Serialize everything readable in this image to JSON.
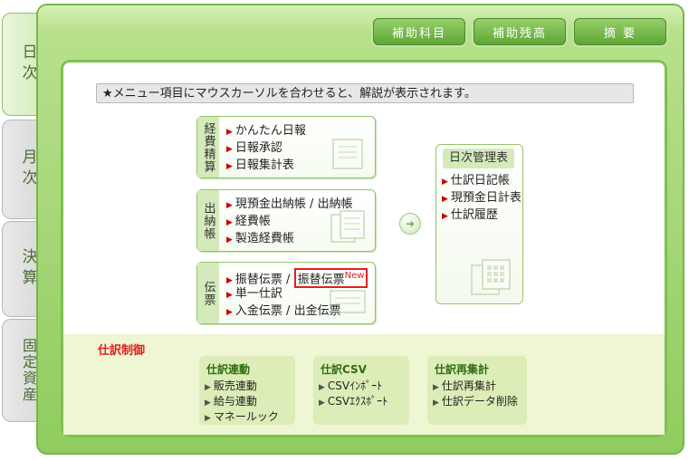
{
  "tabs": [
    {
      "label": "日次"
    },
    {
      "label": "月次"
    },
    {
      "label": "決算"
    },
    {
      "label": "固定資産"
    }
  ],
  "top_buttons": {
    "hojo_kamoku": "補助科目",
    "hojo_zandaka": "補助残高",
    "tekiyo": "摘 要"
  },
  "info_bar": "★メニュー項目にマウスカーソルを合わせると、解説が表示されます。",
  "groups": {
    "keihi": {
      "title": "経費精算",
      "items": [
        "かんたん日報",
        "日報承認",
        "日報集計表"
      ]
    },
    "suitou": {
      "title": "出納帳",
      "items": [
        "現預金出納帳 / 出納帳",
        "経費帳",
        "製造経費帳"
      ]
    },
    "denpyo": {
      "title": "伝票",
      "items": [
        {
          "text": "振替伝票 / ",
          "highlight": "振替伝票",
          "badge": "New"
        },
        {
          "text": "単一仕訳"
        },
        {
          "text": "入金伝票 / 出金伝票"
        }
      ]
    }
  },
  "daily": {
    "title": "日次管理表",
    "items": [
      "仕訳日記帳",
      "現預金日計表",
      "仕訳履歴"
    ]
  },
  "control": {
    "title": "仕訳制御",
    "boxes": [
      {
        "title": "仕訳連動",
        "items": [
          "販売連動",
          "給与連動",
          "マネールック"
        ]
      },
      {
        "title": "仕訳CSV",
        "items": [
          "CSVｲﾝﾎﾟｰﾄ",
          "CSVｴｸｽﾎﾟｰﾄ"
        ]
      },
      {
        "title": "仕訳再集計",
        "items": [
          "仕訳再集計",
          "仕訳データ削除"
        ]
      }
    ]
  },
  "icons": {
    "arrow": "right-arrow-circle-icon",
    "bullet": "red-triangle-icon"
  },
  "colors": {
    "accent_green": "#5ea734",
    "frame_green": "#8fcc5f",
    "bullet_red": "#d00000",
    "new_red": "#e02020",
    "control_bg": "#eef6d4"
  }
}
